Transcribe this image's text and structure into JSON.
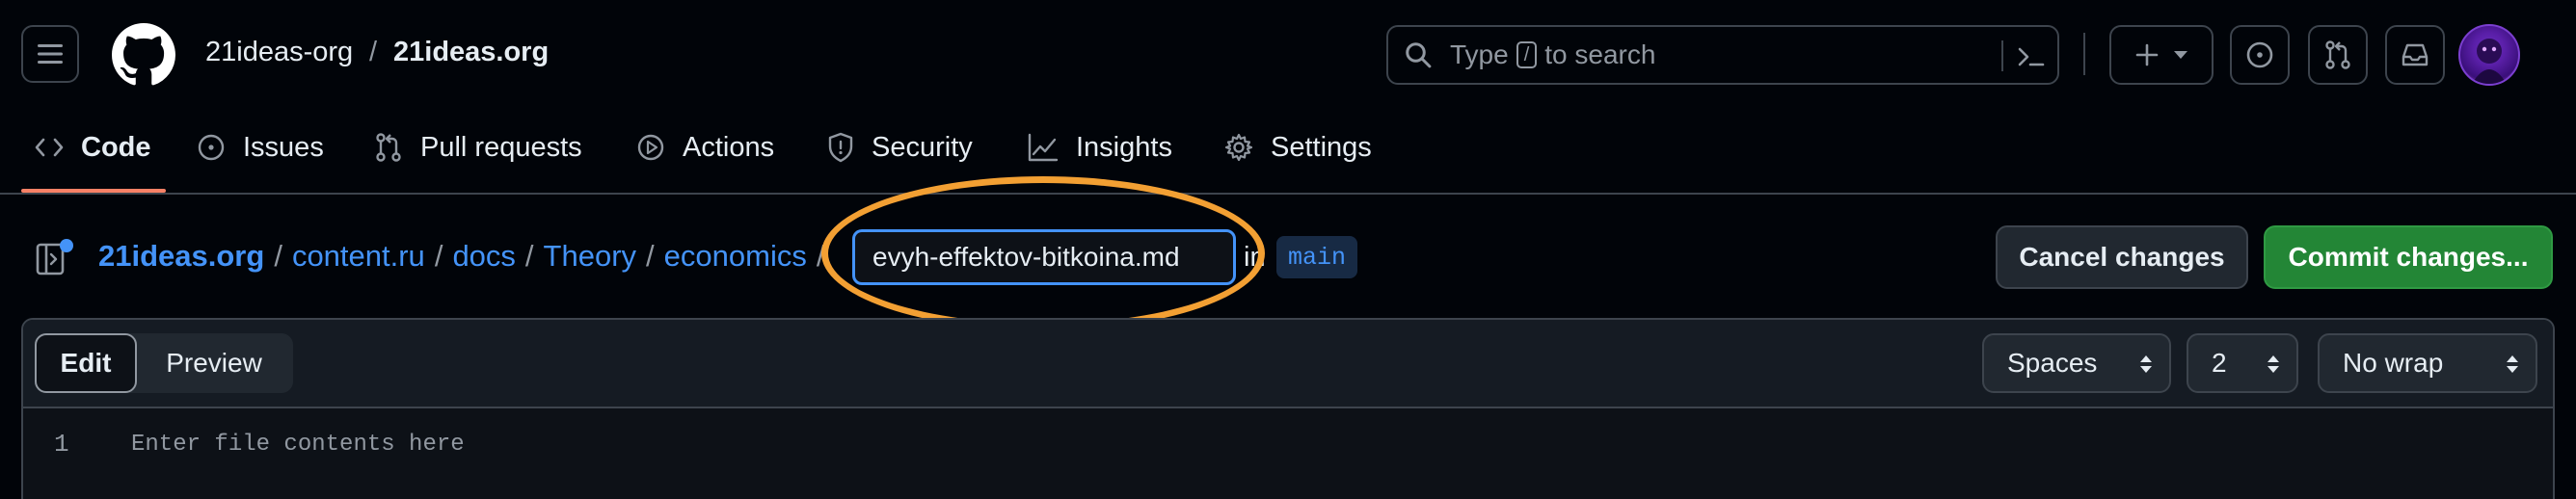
{
  "header": {
    "owner": "21ideas-org",
    "separator": "/",
    "repo": "21ideas.org",
    "search": {
      "placeholder_before": "Type",
      "shortcut_key": "/",
      "placeholder_after": "to search"
    }
  },
  "repo_nav": {
    "tabs": [
      {
        "label": "Code",
        "icon": "code-icon",
        "active": true
      },
      {
        "label": "Issues",
        "icon": "issue-opened-icon"
      },
      {
        "label": "Pull requests",
        "icon": "git-pull-request-icon"
      },
      {
        "label": "Actions",
        "icon": "play-icon"
      },
      {
        "label": "Security",
        "icon": "shield-icon"
      },
      {
        "label": "Insights",
        "icon": "graph-icon"
      },
      {
        "label": "Settings",
        "icon": "gear-icon"
      }
    ]
  },
  "breadcrumb": {
    "repo": "21ideas.org",
    "path": [
      "content.ru",
      "docs",
      "Theory",
      "economics"
    ],
    "separator": "/"
  },
  "filename": {
    "value": "evyh-effektov-bitkoina.md"
  },
  "branch": {
    "prefix": "in",
    "name": "main"
  },
  "actions": {
    "cancel": "Cancel changes",
    "commit": "Commit changes..."
  },
  "editor": {
    "mode_edit": "Edit",
    "mode_preview": "Preview",
    "indent_mode": "Spaces",
    "indent_size": "2",
    "wrap_mode": "No wrap",
    "line_number": "1",
    "placeholder": "Enter file contents here"
  },
  "colors": {
    "background": "#010409",
    "link": "#4493f8",
    "active_tab_underline": "#f78166",
    "commit_button": "#238636",
    "annotation_circle": "#f3a033"
  }
}
